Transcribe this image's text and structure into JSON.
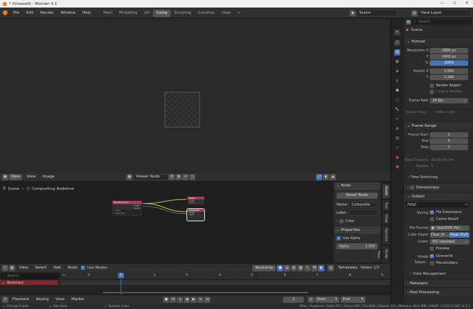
{
  "title": "* (Unsaved) - Blender 4.1",
  "window_controls": {
    "minimize": "—",
    "maximize": "☐",
    "close": "✕"
  },
  "menu": [
    "File",
    "Edit",
    "Render",
    "Window",
    "Help"
  ],
  "workspace_tabs": [
    "Main",
    "Modelling",
    "UV",
    "Comp",
    "Scripting",
    "Cameras",
    "View"
  ],
  "active_tab": "Comp",
  "add_tab": "+",
  "scene_name": "Scene",
  "view_layer": "View Layer",
  "image_editor": {
    "view": "View",
    "view2": "View",
    "image": "Image",
    "image_name": "Viewer Node"
  },
  "breadcrumb": {
    "scene": "Scene",
    "tree": "Compositing Nodetree"
  },
  "nodes": {
    "render_layers": {
      "title": "Render Layers",
      "out1": "Image",
      "out2": "Alpha",
      "field": "Scene",
      "layer": "View Layer"
    },
    "viewer": {
      "title": "Viewer",
      "in1": "Image",
      "in2": "Alpha"
    },
    "composite": {
      "title": "Composite",
      "in1": "Image",
      "in2": "Alpha"
    }
  },
  "node_panel": {
    "header": "Node",
    "reset": "Reset Node",
    "name_label": "Name:",
    "name_value": "Composite",
    "label_label": "Label:",
    "color": "Color",
    "properties": "Properties",
    "use_alpha": "Use Alpha",
    "alpha_label": "Alpha",
    "alpha_value": "1.000"
  },
  "side_tabs": [
    "Node",
    "Tool",
    "View",
    "Options",
    "Node Tree"
  ],
  "node_header": {
    "view": "View",
    "select": "Select",
    "add": "Add",
    "node": "Node",
    "use_nodes": "Use Nodes",
    "backdrop": "Backdrop",
    "templates": "Templates",
    "nodes_count": "Nodes: 1/3"
  },
  "timeline": {
    "view": "View",
    "select": "Select",
    "marker": "Marker",
    "channel": "Channel",
    "frame": "Frame",
    "search_placeholder": "Search",
    "summary": "Summary",
    "current_frame": "1",
    "ticks": [
      "0",
      "1",
      "2",
      "3",
      "4",
      "5",
      "6",
      "7",
      "8",
      "9"
    ],
    "playback": "Playback",
    "keying": "Keying",
    "view2": "View",
    "marker2": "Marker",
    "frame_field": "1",
    "start_label": "Start",
    "start_value": "1",
    "end_label": "End",
    "end_value": "5"
  },
  "properties": {
    "search_placeholder": "Search",
    "scene": "Scene",
    "format_header": "Format",
    "res_x_label": "Resolution X",
    "res_x": "3600 px",
    "res_y_label": "Y",
    "res_y": "2400 px",
    "res_pct_label": "%",
    "res_pct": "100%",
    "aspect_x_label": "Aspect X",
    "aspect_x": "1.000",
    "aspect_y_label": "Y",
    "aspect_y": "1.000",
    "render_region": "Render Region",
    "crop": "Crop to Render ...",
    "frame_rate_label": "Frame Rate",
    "frame_rate": "24 fps",
    "render_res_label": "Render Reso...",
    "render_res": "3600 x 2400",
    "frame_range_header": "Frame Range",
    "frame_start_label": "Frame Start",
    "frame_start": "1",
    "end_label": "End",
    "end": "5",
    "step_label": "Step",
    "step": "1",
    "total_duration_label": "Total Duration",
    "total_duration": "00:00:00+04",
    "frames_label": "Frames",
    "frames": "5",
    "time_stretching": "Time Stretching",
    "stereoscopy": "Stereoscopy",
    "output_header": "Output",
    "output_path": "/tmp\\",
    "saving_label": "Saving",
    "file_extensions": "File Extensions",
    "cache_result": "Cache Result",
    "file_format_label": "File Format",
    "file_format": "OpenEXR Mul...",
    "color_depth_label": "Color Depth",
    "depth_half": "Float (H...",
    "depth_full": "Float (Full)",
    "codec_label": "Codec",
    "codec": "PIZ (lossless)",
    "preview": "Preview",
    "image_seq_label": "Image Seque...",
    "overwrite": "Overwrite",
    "placeholders": "Placeholders",
    "color_management": "Color Management",
    "metadata": "Metadata",
    "post_processing": "Post Processing"
  },
  "status": {
    "change_frame": "Change Frame",
    "pan_view": "Pan View",
    "sample_color": "Sample Color",
    "stats": "Main | Suzanne | Verts:507 | Faces:500 | Tris:968 | Objects:1/1 | Memory: 46.0 MiB | VRAM: 1.0/12.0 GiB | 4.1.1"
  },
  "colors": {
    "accent": "#4772b3",
    "node_header": "#a93a5a",
    "composite_header": "#a93a5a",
    "summary": "#7a2a2a"
  }
}
